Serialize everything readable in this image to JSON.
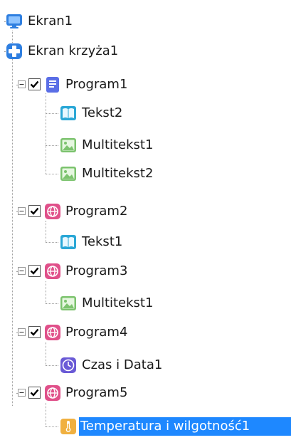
{
  "tree": {
    "ekran1": {
      "label": "Ekran1",
      "icon": "monitor-icon"
    },
    "ekran_krzyza1": {
      "label": "Ekran krzyża1",
      "icon": "plus-icon"
    },
    "program1": {
      "label": "Program1",
      "checked": true,
      "icon": "document-icon",
      "children": [
        {
          "label": "Tekst2",
          "icon": "book-icon"
        },
        {
          "label": "Multitekst1",
          "icon": "image-icon"
        },
        {
          "label": "Multitekst2",
          "icon": "image-icon"
        }
      ]
    },
    "program2": {
      "label": "Program2",
      "checked": true,
      "icon": "globe-icon",
      "children": [
        {
          "label": "Tekst1",
          "icon": "book-icon"
        }
      ]
    },
    "program3": {
      "label": "Program3",
      "checked": true,
      "icon": "globe-icon",
      "children": [
        {
          "label": "Multitekst1",
          "icon": "image-icon"
        }
      ]
    },
    "program4": {
      "label": "Program4",
      "checked": true,
      "icon": "globe-icon",
      "children": [
        {
          "label": "Czas i Data1",
          "icon": "clock-icon"
        }
      ]
    },
    "program5": {
      "label": "Program5",
      "checked": true,
      "icon": "globe-icon",
      "children": [
        {
          "label": "Temperatura i wilgotność1",
          "icon": "thermometer-icon",
          "selected": true
        }
      ]
    }
  },
  "colors": {
    "selection": "#1e88ff",
    "monitor": "#2f7fe0",
    "plus": "#2f7fe0",
    "document": "#5a6ee6",
    "globe": "#e0508a",
    "book": "#2aa7d6",
    "image": "#7cc36e",
    "clock": "#6a5ad6",
    "thermometer": "#f0b040"
  }
}
